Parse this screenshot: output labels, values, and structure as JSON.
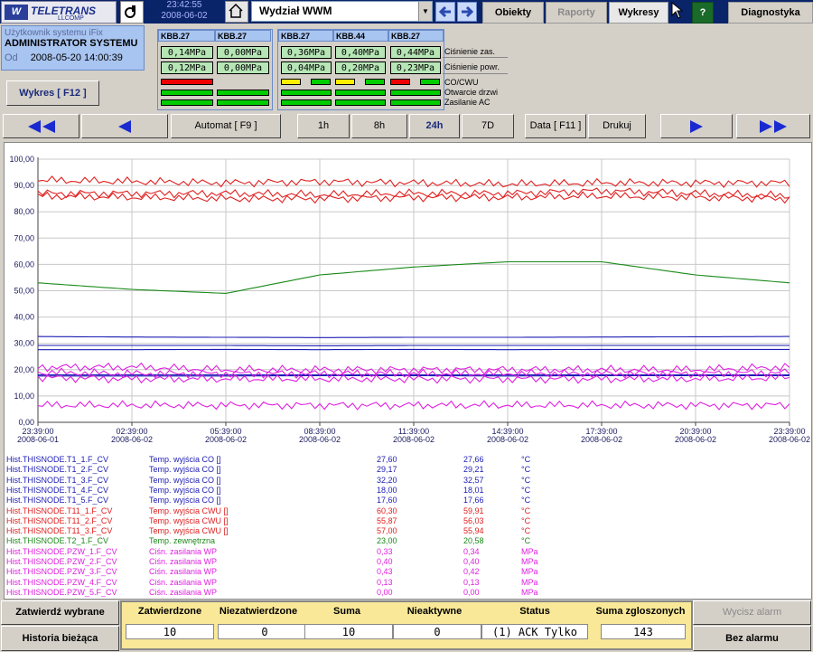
{
  "header": {
    "logo_text": "TELETRANS",
    "logo_sub": "LLCOMP",
    "time": "23:42:55",
    "date": "2008-06-02",
    "area": "Wydział WWM",
    "menu": [
      "Obiekty",
      "Raporty",
      "Wykresy",
      "Diagnostyka"
    ],
    "help": "?"
  },
  "user": {
    "system_label": "Użytkownik systemu iFix",
    "name": "ADMINISTRATOR SYSTEMU",
    "since_label": "Od",
    "since": "2008-05-20 14:00:39"
  },
  "chart_button": "Wykres [ F12 ]",
  "kbb": {
    "groups": [
      {
        "cols": [
          {
            "name": "KBB.27",
            "p1": "0,14MPa",
            "p2": "0,12MPa",
            "co": "r",
            "door": "g",
            "ac": "g"
          },
          {
            "name": "KBB.27",
            "p1": "0,00MPa",
            "p2": "0,00MPa",
            "co": "none",
            "door": "g",
            "ac": "g"
          }
        ]
      },
      {
        "cols": [
          {
            "name": "KBB.27",
            "p1": "0,36MPa",
            "p2": "0,04MPa",
            "co": "yg",
            "door": "g",
            "ac": "g"
          },
          {
            "name": "KBB.44",
            "p1": "0,40MPa",
            "p2": "0,20MPa",
            "co": "yg",
            "door": "g",
            "ac": "g"
          },
          {
            "name": "KBB.27",
            "p1": "0,44MPa",
            "p2": "0,23MPa",
            "co": "rg",
            "door": "g",
            "ac": "g"
          }
        ]
      }
    ],
    "row_labels": [
      "Ciśnienie zas.",
      "Ciśnienie powr.",
      "CO/CWU",
      "Otwarcie drzwi",
      "Zasilanie AC"
    ]
  },
  "toolbar": {
    "automat": "Automat [ F9 ]",
    "ranges": [
      "1h",
      "8h",
      "24h",
      "7D"
    ],
    "active_range": "24h",
    "data": "Data [ F11 ]",
    "print": "Drukuj"
  },
  "chart_data": {
    "type": "line",
    "ylim": [
      0,
      100
    ],
    "yticks": [
      "0,00",
      "10,00",
      "20,00",
      "30,00",
      "40,00",
      "50,00",
      "60,00",
      "70,00",
      "80,00",
      "90,00",
      "100,00"
    ],
    "xticks": [
      {
        "time": "23:39:00",
        "date": "2008-06-01"
      },
      {
        "time": "02:39:00",
        "date": "2008-06-02"
      },
      {
        "time": "05:39:00",
        "date": "2008-06-02"
      },
      {
        "time": "08:39:00",
        "date": "2008-06-02"
      },
      {
        "time": "11:39:00",
        "date": "2008-06-02"
      },
      {
        "time": "14:39:00",
        "date": "2008-06-02"
      },
      {
        "time": "17:39:00",
        "date": "2008-06-02"
      },
      {
        "time": "20:39:00",
        "date": "2008-06-02"
      },
      {
        "time": "23:39:00",
        "date": "2008-06-02"
      }
    ],
    "series": [
      {
        "name": "Hist.THISNODE.T1_1.F_CV",
        "color": "#1c1cb4",
        "values": [
          27.6,
          27.6,
          27.7,
          27.6,
          27.7,
          27.6,
          27.7,
          27.7,
          27.7
        ]
      },
      {
        "name": "Hist.THISNODE.T1_2.F_CV",
        "color": "#1c1cb4",
        "values": [
          29.2,
          29.2,
          29.2,
          29.1,
          29.2,
          29.2,
          29.2,
          29.2,
          29.2
        ]
      },
      {
        "name": "Hist.THISNODE.T1_3.F_CV",
        "color": "#1c1cb4",
        "values": [
          32.6,
          32.4,
          32.3,
          32.2,
          32.3,
          32.3,
          32.4,
          32.5,
          32.6
        ]
      },
      {
        "name": "Hist.THISNODE.T1_4.F_CV",
        "color": "#1c1cb4",
        "values": [
          18.0,
          18.0,
          18.0,
          18.0,
          18.0,
          18.0,
          18.0,
          18.0,
          18.0
        ]
      },
      {
        "name": "Hist.THISNODE.T1_5.F_CV",
        "color": "#1c1cb4",
        "values": [
          17.6,
          17.6,
          17.6,
          17.7,
          17.7,
          17.6,
          17.7,
          17.7,
          17.7
        ]
      },
      {
        "name": "Hist.THISNODE.T11_1.F_CV",
        "color": "#e02020",
        "values": [
          92,
          91.5,
          91,
          91.5,
          91,
          90.5,
          91,
          91,
          91
        ]
      },
      {
        "name": "Hist.THISNODE.T11_2.F_CV",
        "color": "#e02020",
        "values": [
          87,
          87,
          87,
          86.5,
          87,
          87,
          88,
          87,
          86
        ]
      },
      {
        "name": "Hist.THISNODE.T11_3.F_CV",
        "color": "#e02020",
        "values": [
          86,
          85.5,
          85,
          85,
          85.5,
          85.5,
          86,
          85.5,
          85
        ]
      },
      {
        "name": "Hist.THISNODE.T2_1.F_CV",
        "color": "#1a8a1a",
        "values": [
          53,
          50.5,
          49,
          56,
          59,
          61,
          61,
          56,
          53
        ]
      },
      {
        "name": "Hist.THISNODE.PZW_1.F_CV",
        "color": "#e020e0",
        "values": [
          21,
          21,
          20,
          20,
          20,
          20,
          20,
          20,
          21
        ]
      },
      {
        "name": "Hist.THISNODE.PZW_2.F_CV",
        "color": "#e020e0",
        "values": [
          19,
          18.5,
          18.5,
          18.5,
          18.5,
          18.5,
          18.5,
          18.5,
          19
        ]
      },
      {
        "name": "Hist.THISNODE.PZW_3.F_CV",
        "color": "#e020e0",
        "values": [
          17,
          16.5,
          16.5,
          16.5,
          16.5,
          16.5,
          16.5,
          16.5,
          17
        ]
      },
      {
        "name": "Hist.THISNODE.PZW_4.F_CV",
        "color": "#e020e0",
        "values": [
          6.5,
          6.5,
          6.5,
          6.5,
          6.5,
          6.5,
          6.5,
          6.5,
          6.5
        ]
      }
    ]
  },
  "legend": [
    {
      "tag": "Hist.THISNODE.T1_1.F_CV",
      "desc": "Temp. wyjścia CO []",
      "v1": "27,60",
      "v2": "27,66",
      "unit": "°C",
      "color": "#1c1cb4"
    },
    {
      "tag": "Hist.THISNODE.T1_2.F_CV",
      "desc": "Temp. wyjścia CO []",
      "v1": "29,17",
      "v2": "29,21",
      "unit": "°C",
      "color": "#1c1cb4"
    },
    {
      "tag": "Hist.THISNODE.T1_3.F_CV",
      "desc": "Temp. wyjścia CO []",
      "v1": "32,20",
      "v2": "32,57",
      "unit": "°C",
      "color": "#1c1cb4"
    },
    {
      "tag": "Hist.THISNODE.T1_4.F_CV",
      "desc": "Temp. wyjścia CO []",
      "v1": "18,00",
      "v2": "18,01",
      "unit": "°C",
      "color": "#1c1cb4"
    },
    {
      "tag": "Hist.THISNODE.T1_5.F_CV",
      "desc": "Temp. wyjścia CO []",
      "v1": "17,60",
      "v2": "17,66",
      "unit": "°C",
      "color": "#1c1cb4"
    },
    {
      "tag": "Hist.THISNODE.T11_1.F_CV",
      "desc": "Temp. wyjścia CWU []",
      "v1": "60,30",
      "v2": "59,91",
      "unit": "°C",
      "color": "#e02020"
    },
    {
      "tag": "Hist.THISNODE.T11_2.F_CV",
      "desc": "Temp. wyjścia CWU []",
      "v1": "55,87",
      "v2": "56,03",
      "unit": "°C",
      "color": "#e02020"
    },
    {
      "tag": "Hist.THISNODE.T11_3.F_CV",
      "desc": "Temp. wyjścia CWU []",
      "v1": "57,00",
      "v2": "55,94",
      "unit": "°C",
      "color": "#e02020"
    },
    {
      "tag": "Hist.THISNODE.T2_1.F_CV",
      "desc": "Temp. zewnętrzna",
      "v1": "23,00",
      "v2": "20,58",
      "unit": "°C",
      "color": "#1a8a1a"
    },
    {
      "tag": "Hist.THISNODE.PZW_1.F_CV",
      "desc": "Ciśn. zasilania WP",
      "v1": "0,33",
      "v2": "0,34",
      "unit": "MPa",
      "color": "#e020e0"
    },
    {
      "tag": "Hist.THISNODE.PZW_2.F_CV",
      "desc": "Ciśn. zasilania WP",
      "v1": "0,40",
      "v2": "0,40",
      "unit": "MPa",
      "color": "#e020e0"
    },
    {
      "tag": "Hist.THISNODE.PZW_3.F_CV",
      "desc": "Ciśn. zasilania WP",
      "v1": "0,43",
      "v2": "0,42",
      "unit": "MPa",
      "color": "#e020e0"
    },
    {
      "tag": "Hist.THISNODE.PZW_4.F_CV",
      "desc": "Ciśn. zasilania WP",
      "v1": "0,13",
      "v2": "0,13",
      "unit": "MPa",
      "color": "#e020e0"
    },
    {
      "tag": "Hist.THISNODE.PZW_5.F_CV",
      "desc": "Ciśn. zasilania WP",
      "v1": "0,00",
      "v2": "0,00",
      "unit": "MPa",
      "color": "#e020e0"
    }
  ],
  "bottom": {
    "confirm_selected": "Zatwierdź wybrane",
    "history": "Historia bieżąca",
    "columns": [
      {
        "label": "Zatwierdzone",
        "value": "10"
      },
      {
        "label": "Niezatwierdzone",
        "value": "0"
      },
      {
        "label": "Suma",
        "value": "10"
      },
      {
        "label": "Nieaktywne",
        "value": "0"
      },
      {
        "label": "Status",
        "value": "(1) ACK Tylko"
      },
      {
        "label": "Suma zgloszonych",
        "value": "143"
      }
    ],
    "silence": "Wycisz alarm",
    "no_alarm": "Bez alarmu"
  }
}
